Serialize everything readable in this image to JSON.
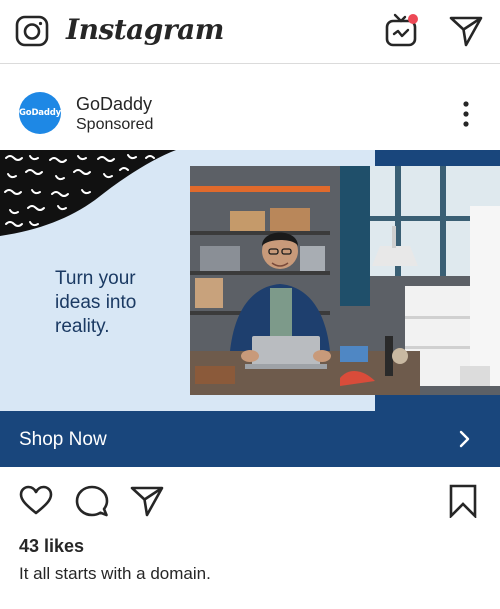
{
  "app": {
    "wordmark": "Instagram"
  },
  "post": {
    "account": {
      "avatar_text": "GoDaddy",
      "username": "GoDaddy",
      "label": "Sponsored"
    },
    "ad": {
      "headline": "Turn your ideas into reality.",
      "cta_label": "Shop Now"
    },
    "likes": "43 likes",
    "caption": "It all starts with a domain."
  },
  "icons": {
    "camera": "camera-icon",
    "igtv": "igtv-icon",
    "direct": "direct-message-icon",
    "more": "more-options-icon",
    "chevron": "chevron-right-icon",
    "like": "heart-icon",
    "comment": "comment-icon",
    "share": "share-icon",
    "save": "bookmark-icon"
  },
  "colors": {
    "brand_navy": "#19467c",
    "ad_background": "#d8e7f5",
    "godaddy_blue": "#1e88e5",
    "notification_dot": "#ed4956",
    "text": "#262626"
  }
}
